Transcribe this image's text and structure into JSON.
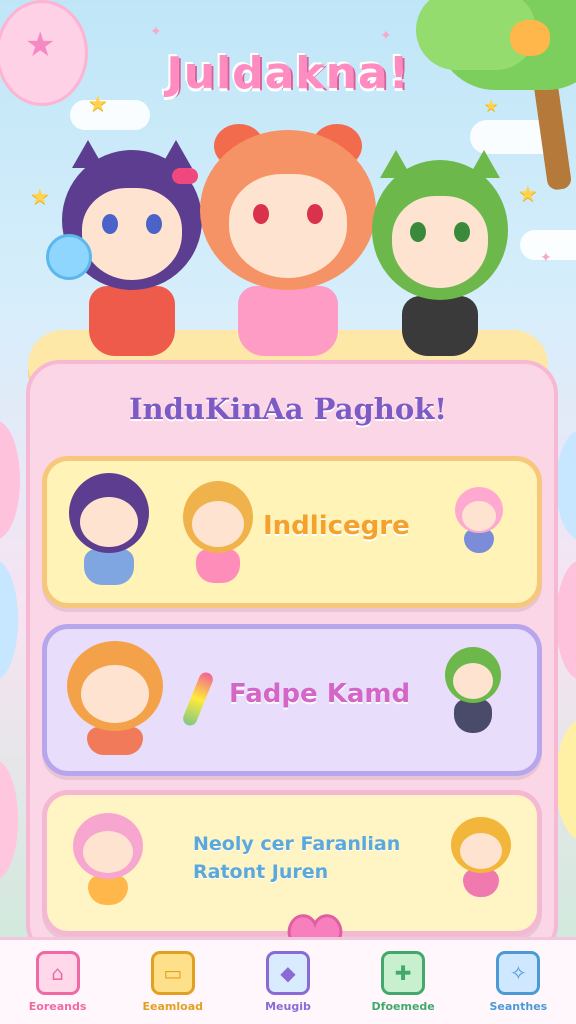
{
  "app": {
    "title": "Juldakna!"
  },
  "panel": {
    "title": "InduKinAa Paghok!"
  },
  "cards": [
    {
      "label": "Indlicegre",
      "color": "#f2a22d",
      "bg": "#fff3b8",
      "border": "#f7c77b"
    },
    {
      "label": "Fadpe Kamd",
      "color": "#d466c8",
      "bg": "#e8ddfa",
      "border": "#b7a5ee"
    },
    {
      "label_line1": "Neoly cer Faranlian",
      "label_line2": "Ratont Juren",
      "color": "#5aa8dc",
      "bg": "#fff4c4",
      "border": "#f5b8d2"
    }
  ],
  "nav": [
    {
      "label": "Eoreands",
      "icon": "house-icon",
      "color": "#ef6aa5"
    },
    {
      "label": "Eeamload",
      "icon": "chat-icon",
      "color": "#e2a021"
    },
    {
      "label": "Meugib",
      "icon": "gift-icon",
      "color": "#8a6bd6"
    },
    {
      "label": "Dfoemede",
      "icon": "puzzle-icon",
      "color": "#43a86b"
    },
    {
      "label": "Seanthes",
      "icon": "map-icon",
      "color": "#4b9ad6"
    }
  ]
}
